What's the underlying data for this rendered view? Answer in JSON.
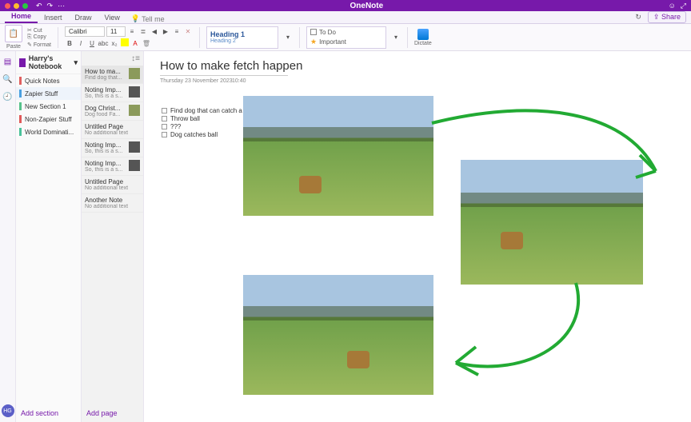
{
  "app": {
    "title": "OneNote"
  },
  "menu": {
    "tabs": [
      "Home",
      "Insert",
      "Draw",
      "View"
    ],
    "active": 0,
    "tell_me": "Tell me",
    "share": "Share"
  },
  "ribbon": {
    "paste": "Paste",
    "cut": "Cut",
    "copy": "Copy",
    "format": "Format",
    "font_name": "Calibri",
    "font_size": "11",
    "styles": {
      "heading1": "Heading 1",
      "heading2": "Heading 2"
    },
    "tags": {
      "todo": "To Do",
      "important": "Important"
    },
    "dictate": "Dictate"
  },
  "notebook": {
    "name": "Harry's Notebook",
    "sections": [
      {
        "name": "Quick Notes",
        "color": "#e06060"
      },
      {
        "name": "Zapier Stuff",
        "color": "#4aa0e0",
        "selected": true
      },
      {
        "name": "New Section 1",
        "color": "#57c28b"
      },
      {
        "name": "Non-Zapier Stuff",
        "color": "#e05a5a"
      },
      {
        "name": "World Dominati...",
        "color": "#4ac29a"
      }
    ],
    "add_section": "Add section"
  },
  "pages": {
    "items": [
      {
        "title": "How to ma...",
        "subtitle": "Find dog that...",
        "thumb": "dog",
        "active": true
      },
      {
        "title": "Noting Imp...",
        "subtitle": "So, this is a s...",
        "thumb": "face"
      },
      {
        "title": "Dog Christ...",
        "subtitle": "Dog food  Fa...",
        "thumb": "dog"
      },
      {
        "title": "Untitled Page",
        "subtitle": "No additional text"
      },
      {
        "title": "Noting Imp...",
        "subtitle": "So, this is a s...",
        "thumb": "face"
      },
      {
        "title": "Noting Imp...",
        "subtitle": "So, this is a s...",
        "thumb": "face"
      },
      {
        "title": "Untitled Page",
        "subtitle": "No additional text"
      },
      {
        "title": "Another Note",
        "subtitle": "No additional text"
      }
    ],
    "add_page": "Add page"
  },
  "note": {
    "title": "How to make fetch happen",
    "date": "Thursday 23 November 2023",
    "time": "10:40",
    "todos": [
      "Find dog that can catch a ball",
      "Throw ball",
      "???",
      "Dog catches ball"
    ]
  },
  "user": {
    "initials": "HG"
  }
}
